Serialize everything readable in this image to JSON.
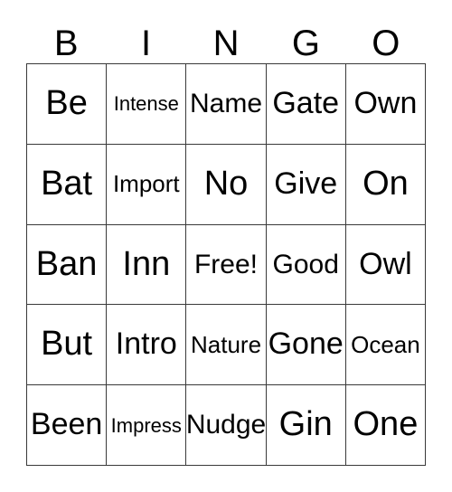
{
  "card": {
    "headers": [
      "B",
      "I",
      "N",
      "G",
      "O"
    ],
    "free_space_label": "Free!",
    "rows": [
      [
        {
          "text": "Be",
          "size": "xl"
        },
        {
          "text": "Intense",
          "size": "xs"
        },
        {
          "text": "Name",
          "size": "md"
        },
        {
          "text": "Gate",
          "size": "lg"
        },
        {
          "text": "Own",
          "size": "lg"
        }
      ],
      [
        {
          "text": "Bat",
          "size": "xl"
        },
        {
          "text": "Import",
          "size": "sm"
        },
        {
          "text": "No",
          "size": "xl"
        },
        {
          "text": "Give",
          "size": "lg"
        },
        {
          "text": "On",
          "size": "xl"
        }
      ],
      [
        {
          "text": "Ban",
          "size": "xl"
        },
        {
          "text": "Inn",
          "size": "xl"
        },
        {
          "text": "Free!",
          "size": "md"
        },
        {
          "text": "Good",
          "size": "md"
        },
        {
          "text": "Owl",
          "size": "lg"
        }
      ],
      [
        {
          "text": "But",
          "size": "xl"
        },
        {
          "text": "Intro",
          "size": "lg"
        },
        {
          "text": "Nature",
          "size": "sm"
        },
        {
          "text": "Gone",
          "size": "lg"
        },
        {
          "text": "Ocean",
          "size": "sm"
        }
      ],
      [
        {
          "text": "Been",
          "size": "lg"
        },
        {
          "text": "Impress",
          "size": "xs"
        },
        {
          "text": "Nudge",
          "size": "md"
        },
        {
          "text": "Gin",
          "size": "xl"
        },
        {
          "text": "One",
          "size": "xl"
        }
      ]
    ]
  },
  "colors": {
    "background": "#ffffff",
    "grid_line": "#3a3a3a",
    "text": "#000000"
  }
}
